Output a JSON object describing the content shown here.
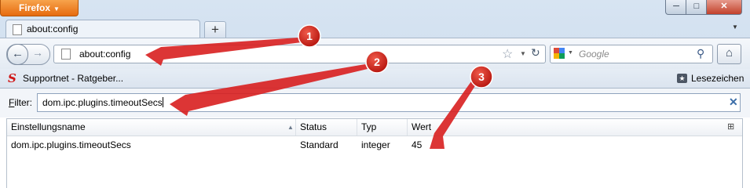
{
  "window": {
    "app_button": "Firefox",
    "controls": {
      "minimize": "─",
      "maximize": "□",
      "close": "✕"
    }
  },
  "tabs": [
    {
      "label": "about:config",
      "active": true
    }
  ],
  "new_tab_label": "+",
  "navbar": {
    "url": "about:config",
    "search_placeholder": "Google"
  },
  "bookmarks": {
    "items": [
      {
        "label": "Supportnet - Ratgeber...",
        "icon": "supportnet-s-icon"
      }
    ],
    "menu_label": "Lesezeichen"
  },
  "filter": {
    "label_accel": "F",
    "label_rest": "ilter:",
    "value": "dom.ipc.plugins.timeoutSecs"
  },
  "table": {
    "headers": {
      "name": "Einstellungsname",
      "status": "Status",
      "type": "Typ",
      "value": "Wert"
    },
    "rows": [
      {
        "name": "dom.ipc.plugins.timeoutSecs",
        "status": "Standard",
        "type": "integer",
        "value": "45"
      }
    ]
  },
  "annotations": [
    {
      "number": "1",
      "target": "url-bar"
    },
    {
      "number": "2",
      "target": "filter-input"
    },
    {
      "number": "3",
      "target": "value-cell"
    }
  ],
  "colors": {
    "firefox_button": "#e66b0f",
    "annotation_red": "#d81f1f",
    "window_frame": "#c4d6ea"
  }
}
